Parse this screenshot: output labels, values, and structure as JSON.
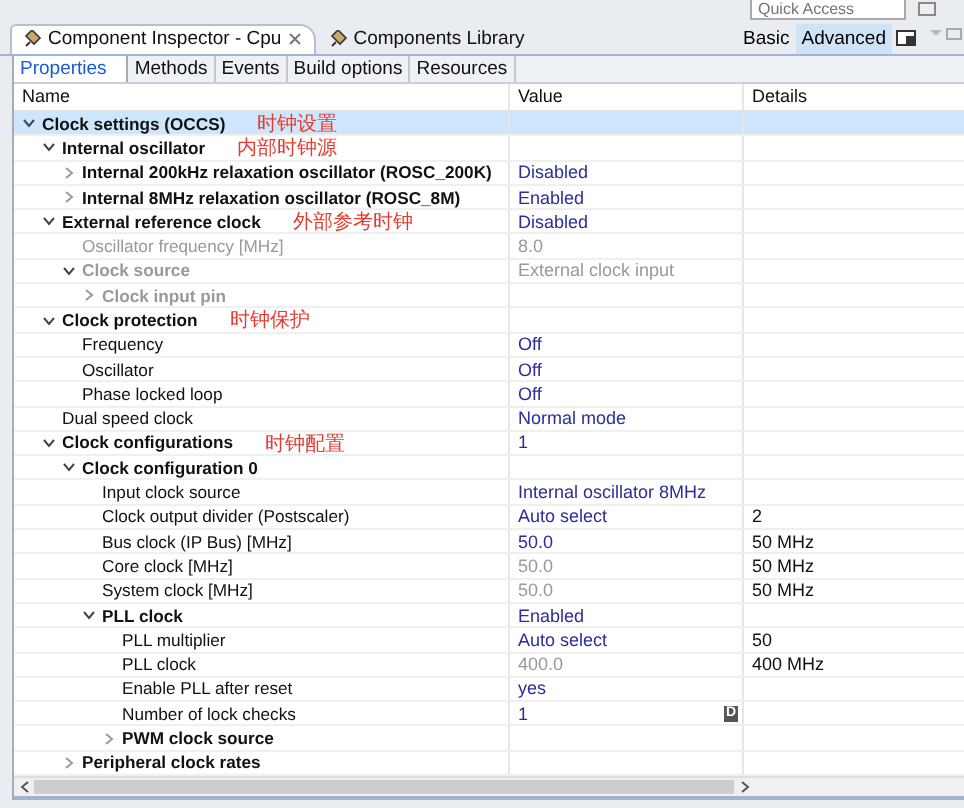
{
  "quick_access": {
    "placeholder": "Quick Access"
  },
  "view_tabs": [
    {
      "label": "Component Inspector - Cpu",
      "selected": true,
      "closable": true
    },
    {
      "label": "Components Library",
      "selected": false,
      "closable": false
    }
  ],
  "mode_buttons": [
    {
      "label": "Basic",
      "selected": false
    },
    {
      "label": "Advanced",
      "selected": true
    }
  ],
  "page_tabs": [
    {
      "label": "Properties",
      "selected": true
    },
    {
      "label": "Methods",
      "selected": false
    },
    {
      "label": "Events",
      "selected": false
    },
    {
      "label": "Build options",
      "selected": false
    },
    {
      "label": "Resources",
      "selected": false
    }
  ],
  "table": {
    "columns": [
      "Name",
      "Value",
      "Details"
    ],
    "rows": [
      {
        "name": "Clock settings (OCCS)",
        "bold": true,
        "expanded": true,
        "selected": true,
        "note": "时钟设置",
        "children": [
          {
            "name": "Internal oscillator",
            "bold": true,
            "expanded": true,
            "selected": false,
            "note": "内部时钟源",
            "children": [
              {
                "name": "Internal 200kHz relaxation oscillator (ROSC_200K)",
                "bold": true,
                "expanded": false,
                "selected": false,
                "value": "Disabled"
              },
              {
                "name": "Internal 8MHz relaxation oscillator (ROSC_8M)",
                "bold": true,
                "expanded": false,
                "selected": false,
                "value": "Enabled"
              }
            ]
          },
          {
            "name": "External reference clock",
            "bold": true,
            "expanded": true,
            "selected": false,
            "value": "Disabled",
            "note": "外部参考时钟",
            "children": [
              {
                "name": "Oscillator frequency [MHz]",
                "disabled": true,
                "selected": false,
                "value": "8.0"
              },
              {
                "name": "Clock source",
                "disabled": true,
                "bold": true,
                "expanded": true,
                "selected": false,
                "value": "External clock input",
                "children": [
                  {
                    "name": "Clock input pin",
                    "disabled": true,
                    "bold": true,
                    "expanded": false,
                    "selected": false
                  }
                ]
              }
            ]
          },
          {
            "name": "Clock protection",
            "bold": true,
            "expanded": true,
            "selected": false,
            "note": "时钟保护",
            "children": [
              {
                "name": "Frequency",
                "selected": false,
                "value": "Off"
              },
              {
                "name": "Oscillator",
                "selected": false,
                "value": "Off"
              },
              {
                "name": "Phase locked loop",
                "selected": false,
                "value": "Off"
              }
            ]
          },
          {
            "name": "Dual speed clock",
            "selected": false,
            "value": "Normal mode"
          },
          {
            "name": "Clock configurations",
            "bold": true,
            "expanded": true,
            "selected": false,
            "value": "1",
            "note": "时钟配置",
            "children": [
              {
                "name": "Clock configuration 0",
                "bold": true,
                "expanded": true,
                "selected": false,
                "children": [
                  {
                    "name": "Input clock source",
                    "selected": false,
                    "value": "Internal oscillator 8MHz"
                  },
                  {
                    "name": "Clock output divider (Postscaler)",
                    "selected": false,
                    "value": "Auto select",
                    "details": "2"
                  },
                  {
                    "name": "Bus clock (IP Bus) [MHz]",
                    "selected": false,
                    "value": "50.0",
                    "details": "50 MHz"
                  },
                  {
                    "name": "Core clock [MHz]",
                    "selected": false,
                    "value": "50.0",
                    "value_disabled": true,
                    "details": "50 MHz"
                  },
                  {
                    "name": "System clock [MHz]",
                    "selected": false,
                    "value": "50.0",
                    "value_disabled": true,
                    "details": "50 MHz"
                  },
                  {
                    "name": "PLL clock",
                    "bold": true,
                    "expanded": true,
                    "selected": false,
                    "value": "Enabled",
                    "children": [
                      {
                        "name": "PLL multiplier",
                        "selected": false,
                        "value": "Auto select",
                        "details": "50"
                      },
                      {
                        "name": "PLL clock",
                        "selected": false,
                        "value": "400.0",
                        "value_disabled": true,
                        "details": "400 MHz"
                      },
                      {
                        "name": "Enable PLL after reset",
                        "selected": false,
                        "value": "yes"
                      },
                      {
                        "name": "Number of lock checks",
                        "selected": false,
                        "value": "1",
                        "badge": "D"
                      },
                      {
                        "name": "PWM clock source",
                        "bold": true,
                        "expanded": false,
                        "selected": false
                      }
                    ]
                  }
                ]
              },
              {
                "name": "Peripheral clock rates",
                "bold": true,
                "expanded": false,
                "selected": false
              }
            ]
          }
        ]
      }
    ]
  }
}
